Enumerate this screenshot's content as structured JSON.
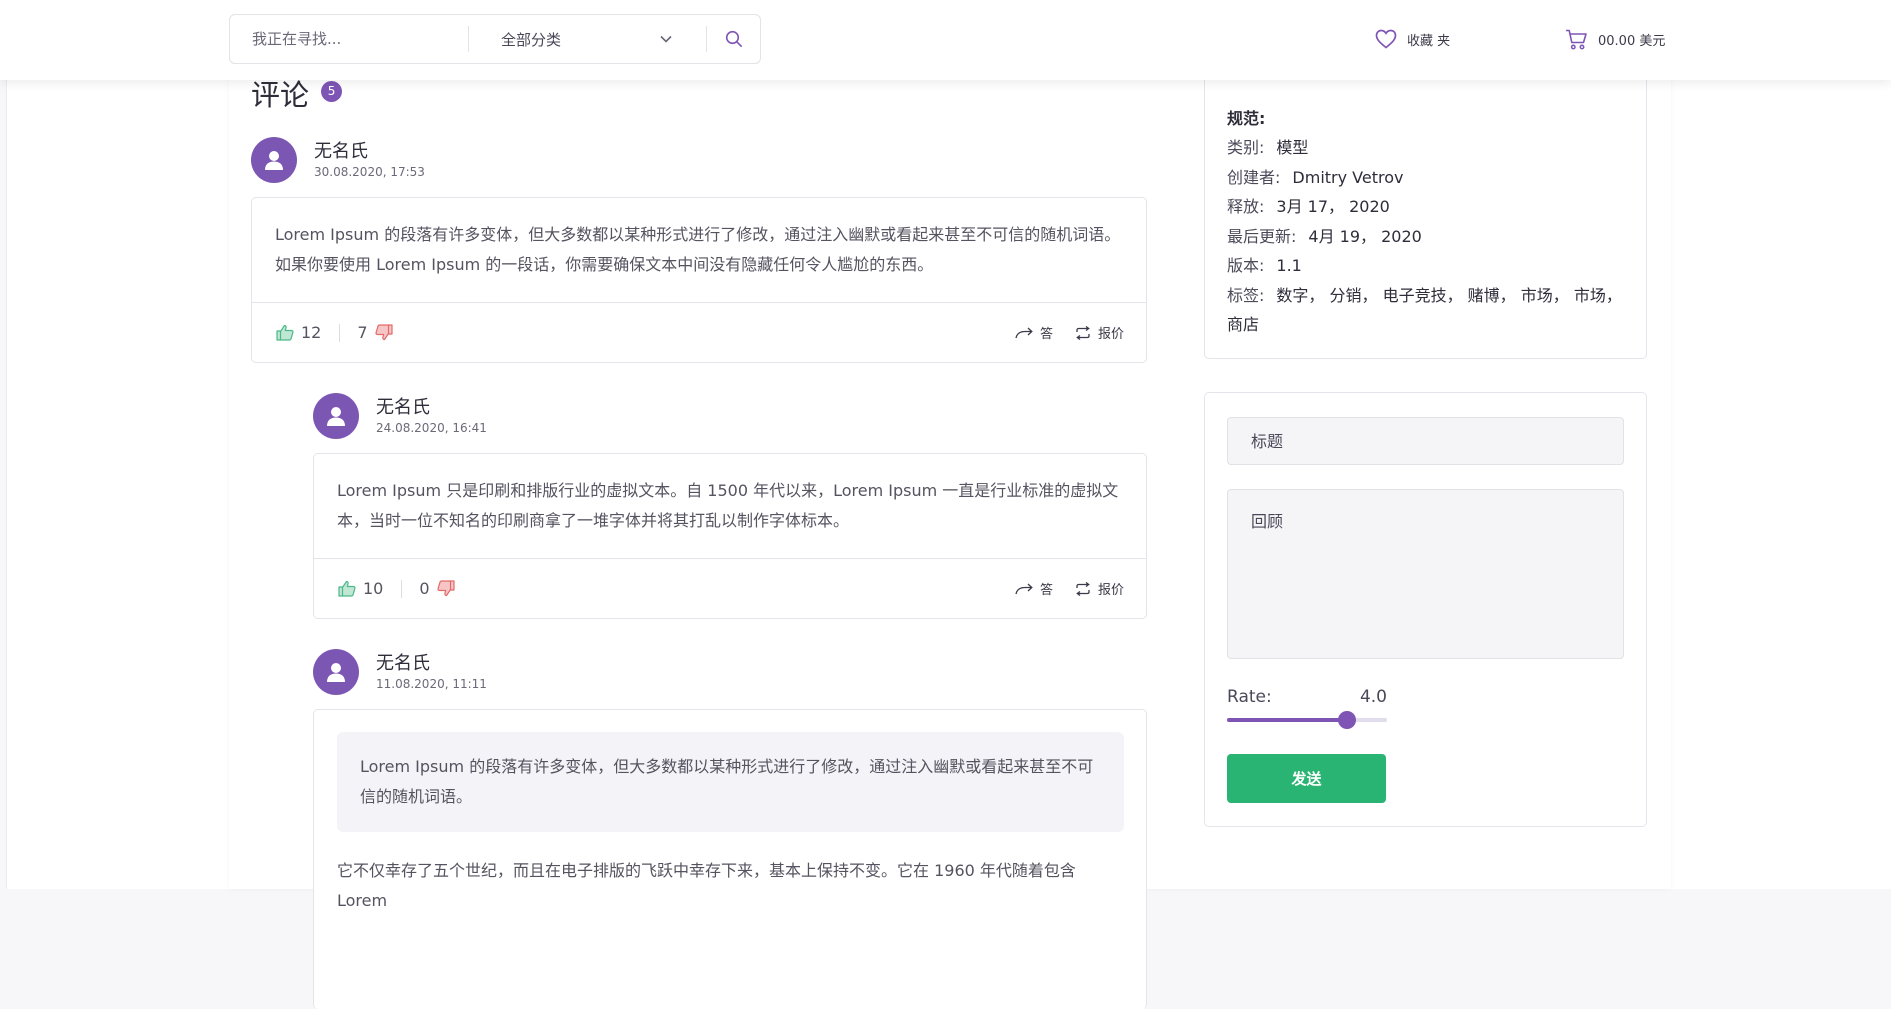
{
  "header": {
    "search_placeholder": "我正在寻找...",
    "category": "全部分类",
    "wishlist_label": "收藏 夹",
    "cart_label": "00.00 美元"
  },
  "reviews": {
    "title": "评论",
    "count": "5",
    "items": [
      {
        "author": "无名氏",
        "date": "30.08.2020, 17:53",
        "text": "Lorem Ipsum 的段落有许多变体，但大多数都以某种形式进行了修改，通过注入幽默或看起来甚至不可信的随机词语。如果你要使用 Lorem Ipsum 的一段话，你需要确保文本中间没有隐藏任何令人尴尬的东西。",
        "likes": "12",
        "dislikes": "7",
        "reply_label": "答",
        "report_label": "报价"
      },
      {
        "author": "无名氏",
        "date": "24.08.2020, 16:41",
        "text": "Lorem Ipsum 只是印刷和排版行业的虚拟文本。自 1500 年代以来，Lorem Ipsum 一直是行业标准的虚拟文本，当时一位不知名的印刷商拿了一堆字体并将其打乱以制作字体标本。",
        "likes": "10",
        "dislikes": "0",
        "reply_label": "答",
        "report_label": "报价"
      },
      {
        "author": "无名氏",
        "date": "11.08.2020, 11:11",
        "quote": "Lorem Ipsum 的段落有许多变体，但大多数都以某种形式进行了修改，通过注入幽默或看起来甚至不可信的随机词语。",
        "text": "它不仅幸存了五个世纪，而且在电子排版的飞跃中幸存下来，基本上保持不变。它在 1960 年代随着包含 Lorem"
      }
    ]
  },
  "specs": {
    "title": "规范:",
    "rows": [
      {
        "label": "类别:",
        "value": "模型"
      },
      {
        "label": "创建者:",
        "value": "Dmitry Vetrov"
      },
      {
        "label": "释放:",
        "value": "3月 17， 2020"
      },
      {
        "label": "最后更新:",
        "value": "4月 19， 2020"
      },
      {
        "label": "版本:",
        "value": "1.1"
      }
    ],
    "tags_label": "标签:",
    "tags_line1": "数字， 分销， 电子竞技， 赌博， 市场， 市场，",
    "tags_line2": "商店"
  },
  "review_form": {
    "title_placeholder": "标题",
    "review_placeholder": "回顾",
    "rate_label": "Rate:",
    "rate_value": "4.0",
    "rate_fraction": 0.75,
    "send_label": "发送"
  },
  "colors": {
    "accent": "#7e55b5",
    "success": "#2ab473",
    "like": "#4cb88a",
    "dislike": "#e36a6a"
  }
}
